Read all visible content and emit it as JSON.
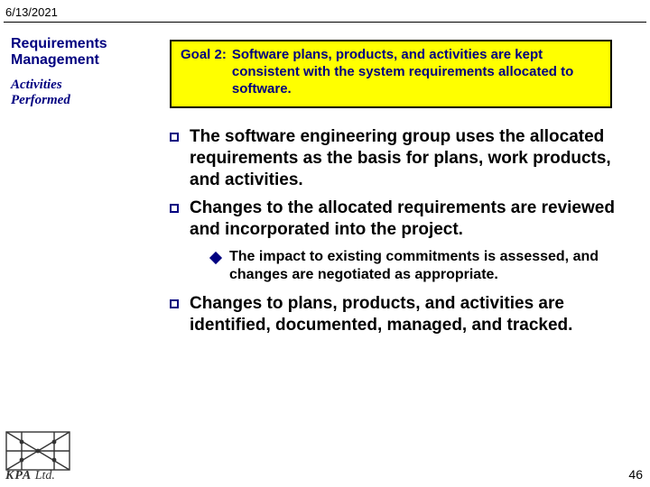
{
  "date": "6/13/2021",
  "side": {
    "title_l1": "Requirements",
    "title_l2": "Management",
    "sub_l1": "Activities",
    "sub_l2": "Performed"
  },
  "goal": {
    "label": "Goal 2:",
    "text": "Software plans, products, and activities are kept consistent with the system requirements allocated to software."
  },
  "bullets": [
    "The software engineering group uses the allocated requirements as the basis for plans, work products, and activities.",
    "Changes to the allocated requirements are reviewed and incorporated into the project."
  ],
  "sub_bullets": [
    "The impact to existing commitments is assessed, and changes are negotiated as appropriate."
  ],
  "bullets2": [
    "Changes to plans, products, and activities are identified, documented, managed, and tracked."
  ],
  "logo": {
    "kpa": "KPA",
    "ltd": " Ltd."
  },
  "page_number": "46"
}
